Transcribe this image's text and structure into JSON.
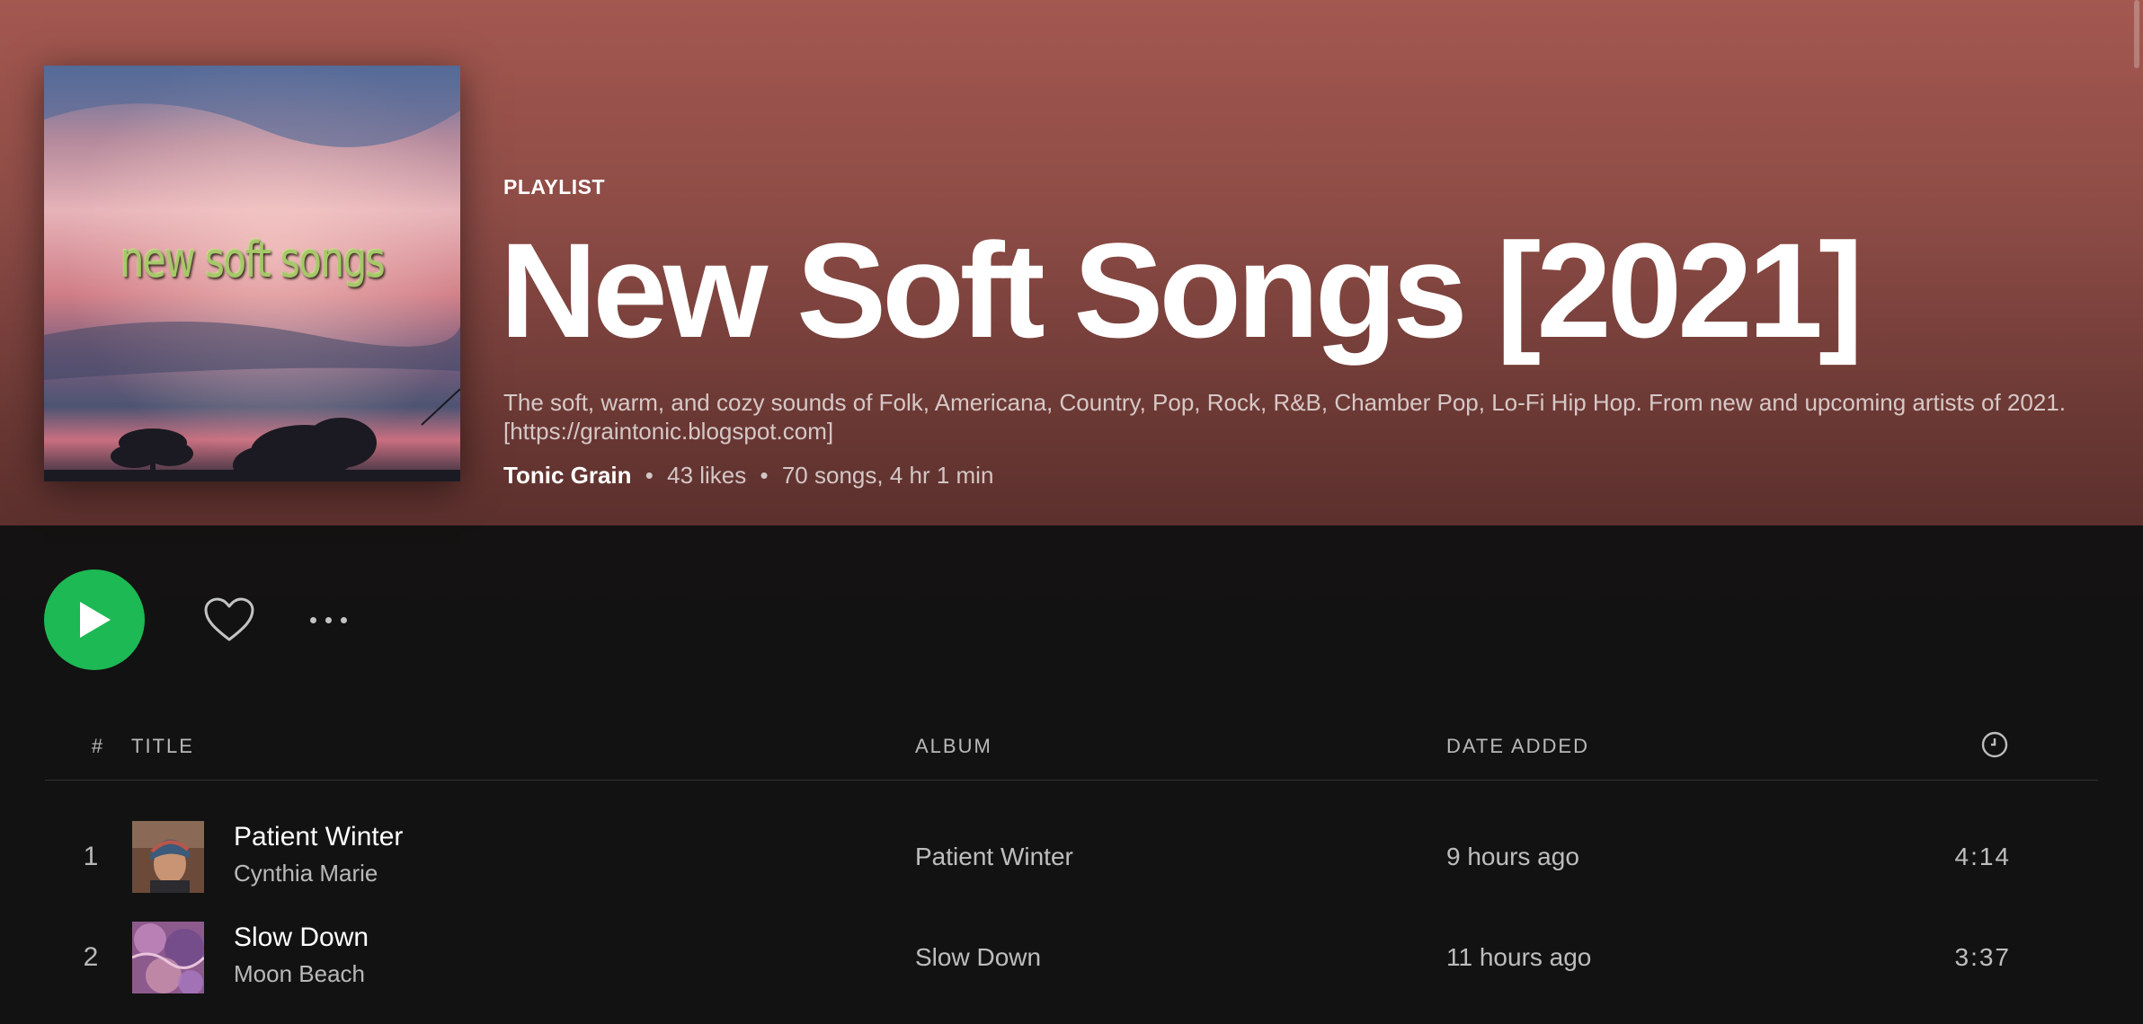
{
  "header": {
    "type_label": "PLAYLIST",
    "title": "New Soft Songs [2021]",
    "description": "The soft, warm, and cozy sounds of Folk, Americana, Country, Pop, Rock, R&B, Chamber Pop, Lo-Fi Hip Hop. From new and upcoming artists of 2021. [https://graintonic.blogspot.com]",
    "owner": "Tonic Grain",
    "likes": "43 likes",
    "stats": "70 songs, 4 hr 1 min",
    "separator": "•",
    "cover_text": "new soft songs"
  },
  "actions": {
    "play_icon": "play-icon",
    "like_icon": "heart-icon",
    "more_icon": "more-dots-icon"
  },
  "table": {
    "columns": {
      "number": "#",
      "title": "TITLE",
      "album": "ALBUM",
      "date_added": "DATE ADDED",
      "duration_icon": "clock-icon"
    },
    "tracks": [
      {
        "number": "1",
        "title": "Patient Winter",
        "artist": "Cynthia Marie",
        "album": "Patient Winter",
        "date_added": "9 hours ago",
        "duration": "4:14"
      },
      {
        "number": "2",
        "title": "Slow Down",
        "artist": "Moon Beach",
        "album": "Slow Down",
        "date_added": "11 hours ago",
        "duration": "3:37"
      }
    ]
  },
  "colors": {
    "accent": "#1db954",
    "hero_top": "#a35850",
    "background": "#121212"
  }
}
